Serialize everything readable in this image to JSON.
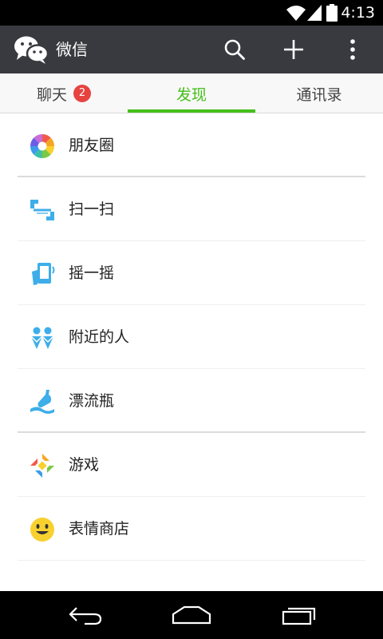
{
  "status_bar": {
    "time": "4:13"
  },
  "action_bar": {
    "title": "微信"
  },
  "tabs": [
    {
      "label": "聊天",
      "badge": "2"
    },
    {
      "label": "发现"
    },
    {
      "label": "通讯录"
    }
  ],
  "list": {
    "items": [
      {
        "label": "朋友圈",
        "icon": "moments-icon"
      },
      {
        "label": "扫一扫",
        "icon": "scan-icon"
      },
      {
        "label": "摇一摇",
        "icon": "shake-icon"
      },
      {
        "label": "附近的人",
        "icon": "people-nearby-icon"
      },
      {
        "label": "漂流瓶",
        "icon": "drift-bottle-icon"
      },
      {
        "label": "游戏",
        "icon": "games-icon"
      },
      {
        "label": "表情商店",
        "icon": "sticker-store-icon"
      }
    ]
  },
  "colors": {
    "accent": "#45c01a",
    "action_bar": "#393a3f",
    "badge": "#e64340",
    "icon_blue": "#3daee9"
  }
}
